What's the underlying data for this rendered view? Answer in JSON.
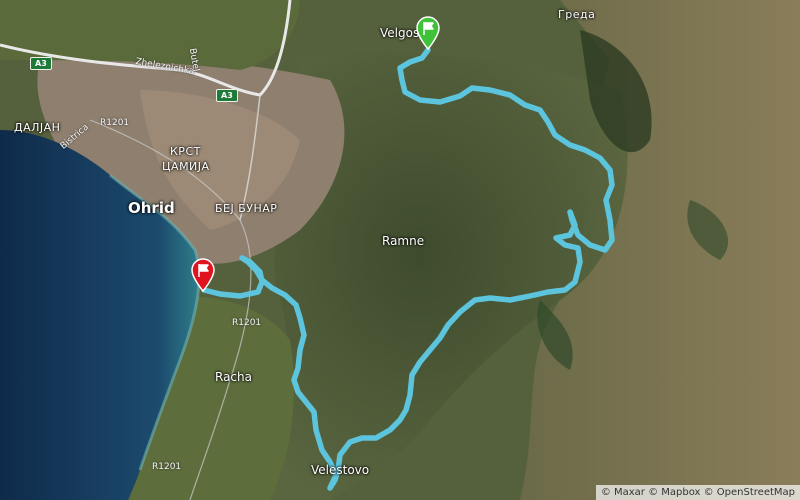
{
  "map": {
    "places": {
      "ohrid": "Ohrid",
      "krst_line1": "КРСТ",
      "krst_line2": "ЦАМИЈА",
      "daljan": "ДАЛЈАН",
      "bej_bunar": "БЕЈ БУНАР",
      "ramne": "Ramne",
      "racha": "Racha",
      "velestovo": "Velestovo",
      "velgosti": "Velgos",
      "greda": "Греда"
    },
    "roads": {
      "a3_shield_1": "A3",
      "a3_shield_2": "A3",
      "zheleznichka": "Zheleznichka",
      "butel": "Butel",
      "bistrica": "Bistrica",
      "r1201_a": "R1201",
      "r1201_b": "R1201",
      "r1201_c": "R1201"
    },
    "markers": {
      "start": {
        "icon": "start-flag-icon",
        "color": "#3fc13a"
      },
      "end": {
        "icon": "finish-flag-icon",
        "color": "#e0141e"
      }
    },
    "route": {
      "color": "#5cc4dc"
    },
    "attribution": "© Maxar © Mapbox © OpenStreetMap"
  }
}
